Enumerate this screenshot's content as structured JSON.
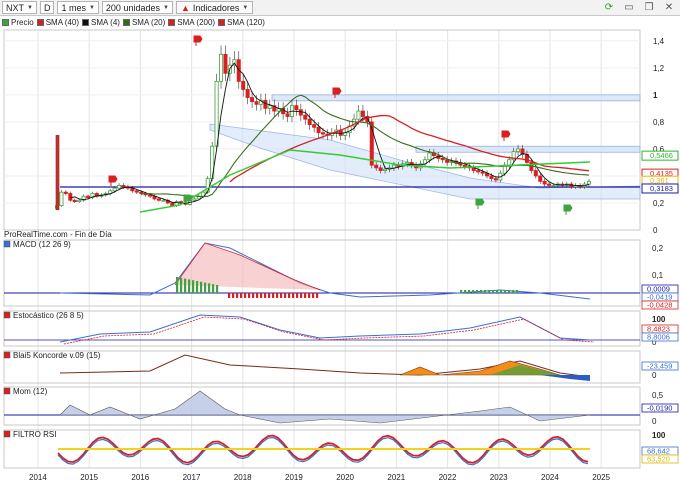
{
  "toolbar": {
    "symbol": "NXT",
    "chart_mode": "D",
    "period": "1 mes",
    "units": "200 unidades",
    "indicators": "Indicadores"
  },
  "legend": [
    {
      "label": "Precio",
      "color": "#3fa33f"
    },
    {
      "label": "SMA (40)",
      "color": "#d92020"
    },
    {
      "label": "SMA (4)",
      "color": "#111111"
    },
    {
      "label": "SMA (20)",
      "color": "#2f6b1f"
    },
    {
      "label": "SMA (200)",
      "color": "#d92020"
    },
    {
      "label": "SMA (120)",
      "color": "#d92020"
    }
  ],
  "colors": {
    "up": "#3fa33f",
    "down": "#d92020",
    "sma40": "#d92020",
    "sma20": "#3c6e1e",
    "sma4": "#111111",
    "sma200": "#33cc33",
    "support": "#1a1aa8",
    "band": "#cfe0f7"
  },
  "watermark": "ProRealTime.com - Fin de Día",
  "price_axis_ticks": [
    "1,4",
    "1,2",
    "1",
    "0,8",
    "0,6",
    "0,4",
    "0,2",
    "0"
  ],
  "price_tags": [
    {
      "label": "0,5466",
      "color": "#2fb52f",
      "value": 0.5466
    },
    {
      "label": "0,4135",
      "color": "#d92020",
      "value": 0.4135
    },
    {
      "label": "0,361",
      "color": "#f2b500",
      "value": 0.361
    },
    {
      "label": "0,3183",
      "color": "#1a1aa8",
      "value": 0.3183
    }
  ],
  "panels": [
    {
      "title": "MACD (12 26 9)",
      "ticks": [
        "0,2",
        "0,1",
        "0"
      ],
      "tags": [
        {
          "label": "0,0009",
          "color": "#1a1aa8"
        },
        {
          "label": "-0,0419",
          "color": "#3b6fd4"
        },
        {
          "label": "-0,0428",
          "color": "#d92020"
        }
      ]
    },
    {
      "title": "Estocástico (26 8 5)",
      "ticks": [
        "100",
        "0"
      ],
      "tags": [
        {
          "label": "8,4823",
          "color": "#d92020"
        },
        {
          "label": "8,8006",
          "color": "#3b6fd4"
        }
      ]
    },
    {
      "title": "Blai5 Koncorde v.09 (15)",
      "ticks": [
        "0"
      ],
      "tags": [
        {
          "label": "-23,459",
          "color": "#3b6fd4"
        }
      ]
    },
    {
      "title": "Mom (12)",
      "ticks": [
        "0,5",
        "0"
      ],
      "tags": [
        {
          "label": "-0,0190",
          "color": "#1a1aa8"
        }
      ]
    },
    {
      "title": "FILTRO RSI",
      "ticks": [
        "100"
      ],
      "tags": [
        {
          "label": "68,642",
          "color": "#3b6fd4"
        },
        {
          "label": "63,520",
          "color": "#e0b800"
        }
      ]
    }
  ],
  "x_axis": [
    "2014",
    "2015",
    "2016",
    "2017",
    "2018",
    "2019",
    "2020",
    "2021",
    "2022",
    "2023",
    "2024",
    "2025"
  ]
}
